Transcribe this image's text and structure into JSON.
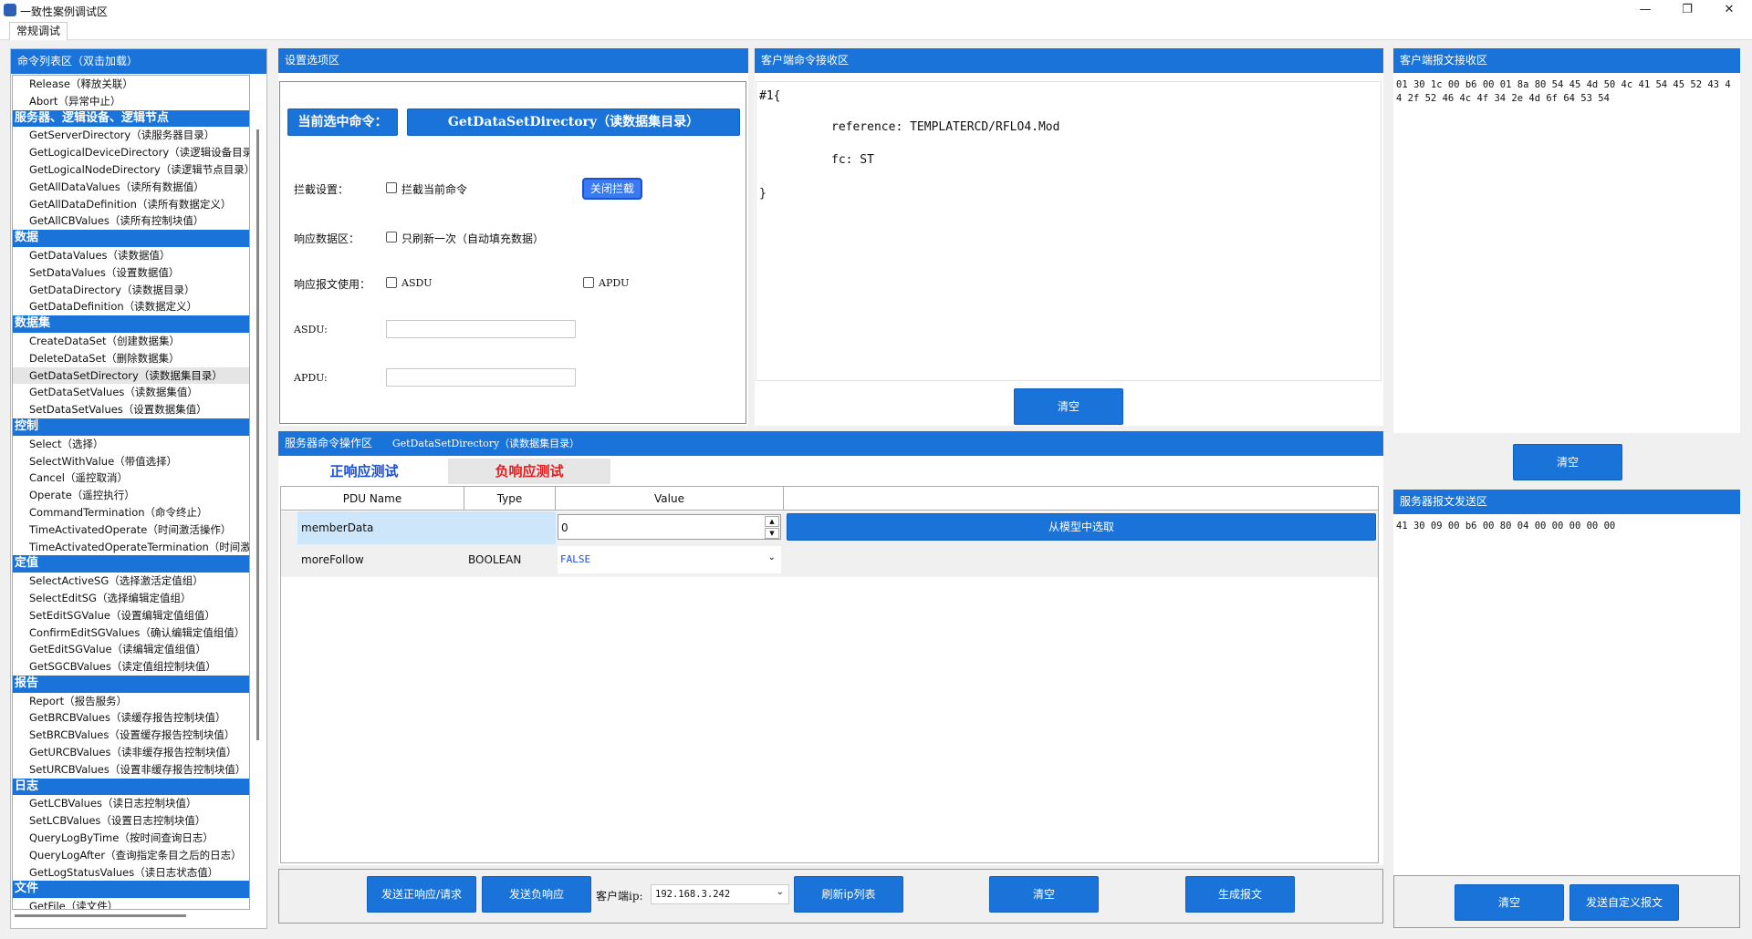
{
  "window": {
    "title": "一致性案例调试区",
    "min": "—",
    "max": "❐",
    "close": "✕"
  },
  "tabs": [
    "常规调试"
  ],
  "cmd_panel": {
    "title": "命令列表区（双击加载）",
    "rows": [
      {
        "t": "item",
        "label": "Release（释放关联）"
      },
      {
        "t": "item",
        "label": "Abort（异常中止）"
      },
      {
        "t": "cat",
        "label": "服务器、逻辑设备、逻辑节点"
      },
      {
        "t": "item",
        "label": "GetServerDirectory（读服务器目录）"
      },
      {
        "t": "item",
        "label": "GetLogicalDeviceDirectory（读逻辑设备目录）"
      },
      {
        "t": "item",
        "label": "GetLogicalNodeDirectory（读逻辑节点目录）"
      },
      {
        "t": "item",
        "label": "GetAllDataValues（读所有数据值）"
      },
      {
        "t": "item",
        "label": "GetAllDataDefinition（读所有数据定义）"
      },
      {
        "t": "item",
        "label": "GetAllCBValues（读所有控制块值）"
      },
      {
        "t": "cat",
        "label": "数据"
      },
      {
        "t": "item",
        "label": "GetDataValues（读数据值）"
      },
      {
        "t": "item",
        "label": "SetDataValues（设置数据值）"
      },
      {
        "t": "item",
        "label": "GetDataDirectory（读数据目录）"
      },
      {
        "t": "item",
        "label": "GetDataDefinition（读数据定义）"
      },
      {
        "t": "cat",
        "label": "数据集"
      },
      {
        "t": "item",
        "label": "CreateDataSet（创建数据集）"
      },
      {
        "t": "item",
        "label": "DeleteDataSet（删除数据集）"
      },
      {
        "t": "item",
        "label": "GetDataSetDirectory（读数据集目录）",
        "sel": true
      },
      {
        "t": "item",
        "label": "GetDataSetValues（读数据集值）"
      },
      {
        "t": "item",
        "label": "SetDataSetValues（设置数据集值）"
      },
      {
        "t": "cat",
        "label": "控制"
      },
      {
        "t": "item",
        "label": "Select（选择）"
      },
      {
        "t": "item",
        "label": "SelectWithValue（带值选择）"
      },
      {
        "t": "item",
        "label": "Cancel（遥控取消）"
      },
      {
        "t": "item",
        "label": "Operate（遥控执行）"
      },
      {
        "t": "item",
        "label": "CommandTermination（命令终止）"
      },
      {
        "t": "item",
        "label": "TimeActivatedOperate（时间激活操作）"
      },
      {
        "t": "item",
        "label": "TimeActivatedOperateTermination（时间激活操作终止）"
      },
      {
        "t": "cat",
        "label": "定值"
      },
      {
        "t": "item",
        "label": "SelectActiveSG（选择激活定值组）"
      },
      {
        "t": "item",
        "label": "SelectEditSG（选择编辑定值组）"
      },
      {
        "t": "item",
        "label": "SetEditSGValue（设置编辑定值组值）"
      },
      {
        "t": "item",
        "label": "ConfirmEditSGValues（确认编辑定值组值）"
      },
      {
        "t": "item",
        "label": "GetEditSGValue（读编辑定值组值）"
      },
      {
        "t": "item",
        "label": "GetSGCBValues（读定值组控制块值）"
      },
      {
        "t": "cat",
        "label": "报告"
      },
      {
        "t": "item",
        "label": "Report（报告服务）"
      },
      {
        "t": "item",
        "label": "GetBRCBValues（读缓存报告控制块值）"
      },
      {
        "t": "item",
        "label": "SetBRCBValues（设置缓存报告控制块值）"
      },
      {
        "t": "item",
        "label": "GetURCBValues（读非缓存报告控制块值）"
      },
      {
        "t": "item",
        "label": "SetURCBValues（设置非缓存报告控制块值）"
      },
      {
        "t": "cat",
        "label": "日志"
      },
      {
        "t": "item",
        "label": "GetLCBValues（读日志控制块值）"
      },
      {
        "t": "item",
        "label": "SetLCBValues（设置日志控制块值）"
      },
      {
        "t": "item",
        "label": "QueryLogByTime（按时间查询日志）"
      },
      {
        "t": "item",
        "label": "QueryLogAfter（查询指定条目之后的日志）"
      },
      {
        "t": "item",
        "label": "GetLogStatusValues（读日志状态值）"
      },
      {
        "t": "cat",
        "label": "文件"
      },
      {
        "t": "item",
        "label": "GetFile（读文件）"
      }
    ]
  },
  "settings": {
    "title": "设置选项区",
    "current_label": "当前选中命令：",
    "current_value": "GetDataSetDirectory（读数据集目录）",
    "intercept_label": "拦截设置：",
    "intercept_check": "拦截当前命令",
    "intercept_button": "关闭拦截",
    "resp_label": "响应数据区：",
    "resp_check": "只刷新一次（自动填充数据）",
    "msg_label": "响应报文使用：",
    "asdu_check": "ASDU",
    "apdu_check": "APDU",
    "asdu_field_label": "ASDU:",
    "apdu_field_label": "APDU:"
  },
  "client_cmd": {
    "title": "客户端命令接收区",
    "lines": [
      "#1{",
      "reference: TEMPLATERCD/RFLO4.Mod",
      "fc: ST",
      "}"
    ],
    "clear": "清空"
  },
  "client_msg": {
    "title": "客户端报文接收区",
    "hex": "01 30 1c 00 b6 00 01 8a 80 54 45 4d 50 4c 41 54 45 52 43 44 2f 52 46 4c 4f 34 2e 4d 6f 64 53 54",
    "clear": "清空"
  },
  "server_send": {
    "title": "服务器报文发送区",
    "hex": "41 30 09 00 b6 00 80 04 00 00 00 00 00",
    "clear": "清空",
    "send_custom": "发送自定义报文"
  },
  "server_op": {
    "title": "服务器命令操作区",
    "subtitle": "GetDataSetDirectory（读数据集目录）",
    "tab_positive": "正响应测试",
    "tab_negative": "负响应测试",
    "columns": [
      "PDU Name",
      "Type",
      "Value"
    ],
    "rows": [
      {
        "name": "memberData",
        "type": "",
        "value": "0",
        "action": "从模型中选取"
      },
      {
        "name": "moreFollow",
        "type": "BOOLEAN",
        "value": "FALSE"
      }
    ],
    "buttons": {
      "send_pos": "发送正响应/请求",
      "send_neg": "发送负响应",
      "client_ip_label": "客户端ip:",
      "client_ip": "192.168.3.242",
      "refresh": "刷新ip列表",
      "clear": "清空",
      "gen": "生成报文"
    }
  },
  "colors": {
    "accent": "#1a73d9",
    "positive_tab": "#1a4fd6",
    "negative_tab": "#e02020"
  }
}
